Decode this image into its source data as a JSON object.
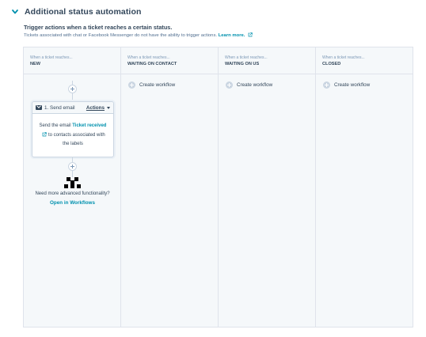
{
  "header": {
    "title": "Additional status automation",
    "chevron_icon": "chevron-down-icon"
  },
  "intro": {
    "subtitle": "Trigger actions when a ticket reaches a certain status.",
    "description": "Tickets associated with chat or Facebook Messenger do not have the ability to trigger actions.",
    "learn_more": "Learn more."
  },
  "columns": [
    {
      "pre_label": "When a ticket reaches...",
      "status": "NEW"
    },
    {
      "pre_label": "When a ticket reaches...",
      "status": "WAITING ON CONTACT",
      "action_label": "Create workflow"
    },
    {
      "pre_label": "When a ticket reaches...",
      "status": "WAITING ON US",
      "action_label": "Create workflow"
    },
    {
      "pre_label": "When a ticket reaches...",
      "status": "CLOSED",
      "action_label": "Create workflow"
    }
  ],
  "workflow": {
    "step_title": "1. Send email",
    "actions_label": "Actions",
    "body_prefix": "Send the email",
    "email_link": "Ticket received",
    "body_suffix": "to contacts associated with the labels",
    "more_text": "Need more advanced functionality?",
    "open_link": "Open in Workflows"
  },
  "colors": {
    "accent": "#0091ae",
    "text": "#33475b",
    "board_bg": "#f5f8fa",
    "border": "#dfe3eb"
  }
}
